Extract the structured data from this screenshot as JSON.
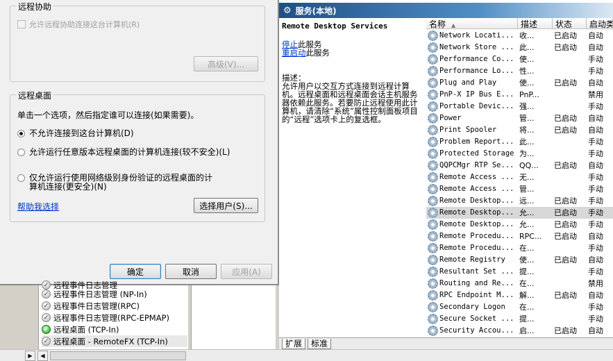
{
  "dialog": {
    "remote_assist": {
      "title": "远程协助",
      "allow_checkbox": "允许远程协助连接这台计算机(R)",
      "advanced_button": "高级(V)..."
    },
    "remote_desktop": {
      "title": "远程桌面",
      "description": "单击一个选项，然后指定谁可以连接(如果需要)。",
      "options": [
        {
          "label": "不允许连接到这台计算机(D)",
          "selected": true
        },
        {
          "label": "允许运行任意版本远程桌面的计算机连接(较不安全)(L)",
          "selected": false
        },
        {
          "label_line1": "仅允许运行使用网络级别身份验证的远程桌面的计",
          "label_line2": "算机连接(更安全)(N)",
          "selected": false
        }
      ],
      "help_link": "帮助我选择",
      "select_users_button": "选择用户(S)..."
    },
    "buttons": {
      "ok": "确定",
      "cancel": "取消",
      "apply": "应用(A)"
    }
  },
  "tree": {
    "partial_top": "远程事件日志管理",
    "items": [
      {
        "label": "远程事件日志管理 (NP-In)",
        "icon": "disabled-rule-icon"
      },
      {
        "label": "远程事件日志管理(RPC)",
        "icon": "disabled-rule-icon"
      },
      {
        "label": "远程事件日志管理(RPC-EPMAP)",
        "icon": "disabled-rule-icon"
      },
      {
        "label": "远程桌面 (TCP-In)",
        "icon": "enabled-rule-icon"
      },
      {
        "label": "远程桌面 - RemoteFX (TCP-In)",
        "icon": "disabled-rule-icon"
      }
    ]
  },
  "services": {
    "title": "服务(本地)",
    "selected_name": "Remote Desktop Services",
    "stop_link": "停止",
    "stop_suffix": "此服务",
    "restart_link": "重启动",
    "restart_suffix": "此服务",
    "desc_label": "描述：",
    "desc_text": "允许用户以交互方式连接到远程计算机。远程桌面和远程桌面会话主机服务器依赖此服务。若要防止远程使用此计算机，请清除“系统”属性控制面板项目的“远程”选项卡上的复选框。",
    "columns": {
      "name": "名称",
      "desc": "描述",
      "status": "状态",
      "startup": "启动类"
    },
    "rows": [
      {
        "name": "Network Locati...",
        "desc": "收...",
        "status": "已启动",
        "startup": "自动"
      },
      {
        "name": "Network Store ...",
        "desc": "此...",
        "status": "已启动",
        "startup": "自动"
      },
      {
        "name": "Performance Co...",
        "desc": "使...",
        "status": "",
        "startup": "手动"
      },
      {
        "name": "Performance Lo...",
        "desc": "性...",
        "status": "",
        "startup": "手动"
      },
      {
        "name": "Plug and Play",
        "desc": "使...",
        "status": "已启动",
        "startup": "自动"
      },
      {
        "name": "PnP-X IP Bus E...",
        "desc": "PnP...",
        "status": "",
        "startup": "禁用"
      },
      {
        "name": "Portable Devic...",
        "desc": "强...",
        "status": "",
        "startup": "手动"
      },
      {
        "name": "Power",
        "desc": "管...",
        "status": "已启动",
        "startup": "自动"
      },
      {
        "name": "Print Spooler",
        "desc": "将...",
        "status": "已启动",
        "startup": "自动"
      },
      {
        "name": "Problem Report...",
        "desc": "此...",
        "status": "",
        "startup": "手动"
      },
      {
        "name": "Protected Storage",
        "desc": "为...",
        "status": "",
        "startup": "手动"
      },
      {
        "name": "QQPCMgr RTP Se...",
        "desc": "QQ...",
        "status": "已启动",
        "startup": "自动"
      },
      {
        "name": "Remote Access ...",
        "desc": "无...",
        "status": "",
        "startup": "手动"
      },
      {
        "name": "Remote Access ...",
        "desc": "管...",
        "status": "",
        "startup": "手动"
      },
      {
        "name": "Remote Desktop...",
        "desc": "远...",
        "status": "已启动",
        "startup": "手动"
      },
      {
        "name": "Remote Desktop...",
        "desc": "允...",
        "status": "已启动",
        "startup": "手动",
        "selected": true
      },
      {
        "name": "Remote Desktop...",
        "desc": "允...",
        "status": "已启动",
        "startup": "手动"
      },
      {
        "name": "Remote Procedu...",
        "desc": "RPC...",
        "status": "已启动",
        "startup": "自动"
      },
      {
        "name": "Remote Procedu...",
        "desc": "在...",
        "status": "",
        "startup": "手动"
      },
      {
        "name": "Remote Registry",
        "desc": "使...",
        "status": "已启动",
        "startup": "自动"
      },
      {
        "name": "Resultant Set ...",
        "desc": "提...",
        "status": "",
        "startup": "手动"
      },
      {
        "name": "Routing and Re...",
        "desc": "在...",
        "status": "",
        "startup": "禁用"
      },
      {
        "name": "RPC Endpoint M...",
        "desc": "解...",
        "status": "已启动",
        "startup": "自动"
      },
      {
        "name": "Secondary Logon",
        "desc": "在...",
        "status": "",
        "startup": "手动"
      },
      {
        "name": "Secure Socket ...",
        "desc": "提...",
        "status": "",
        "startup": "手动"
      },
      {
        "name": "Security Accou...",
        "desc": "启...",
        "status": "已启动",
        "startup": "自动"
      }
    ],
    "tabs": [
      "扩展",
      "标准"
    ]
  }
}
